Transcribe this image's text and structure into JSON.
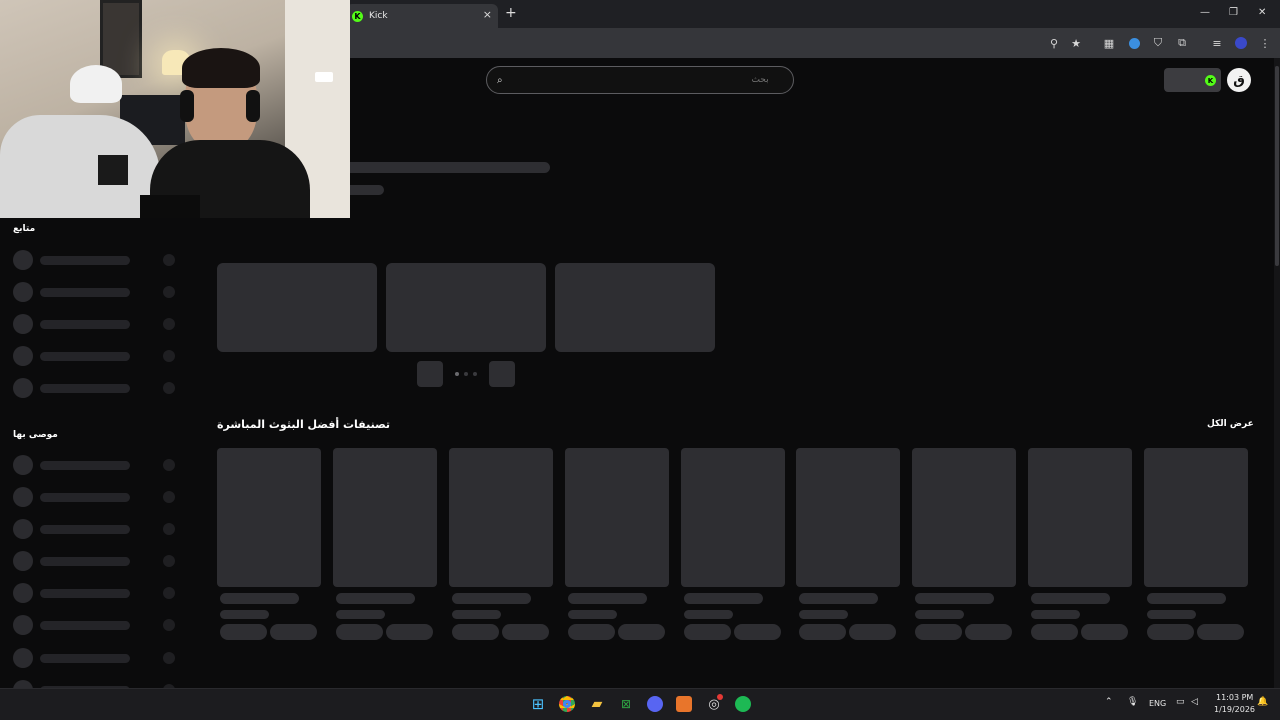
{
  "browser": {
    "tab_title": "Kick",
    "tab_close": "×",
    "new_tab": "+",
    "window_minimize": "—",
    "window_restore": "❐",
    "window_close": "✕"
  },
  "header": {
    "search_placeholder": "بحث",
    "logo_text": "ق",
    "green_badge": "K"
  },
  "sidebar": {
    "following_title": "متابع",
    "recommended_title": "موصى بها"
  },
  "main": {
    "categories_title": "تصنيفات أفضل البثوث المباشرة",
    "view_all": "عرض الكل"
  },
  "taskbar": {
    "lang": "ENG",
    "time": "11:03 PM",
    "date": "1/19/2026"
  },
  "colors": {
    "accent": "#53fc18",
    "background": "#0b0b0c",
    "skeleton": "#2e2e32"
  }
}
